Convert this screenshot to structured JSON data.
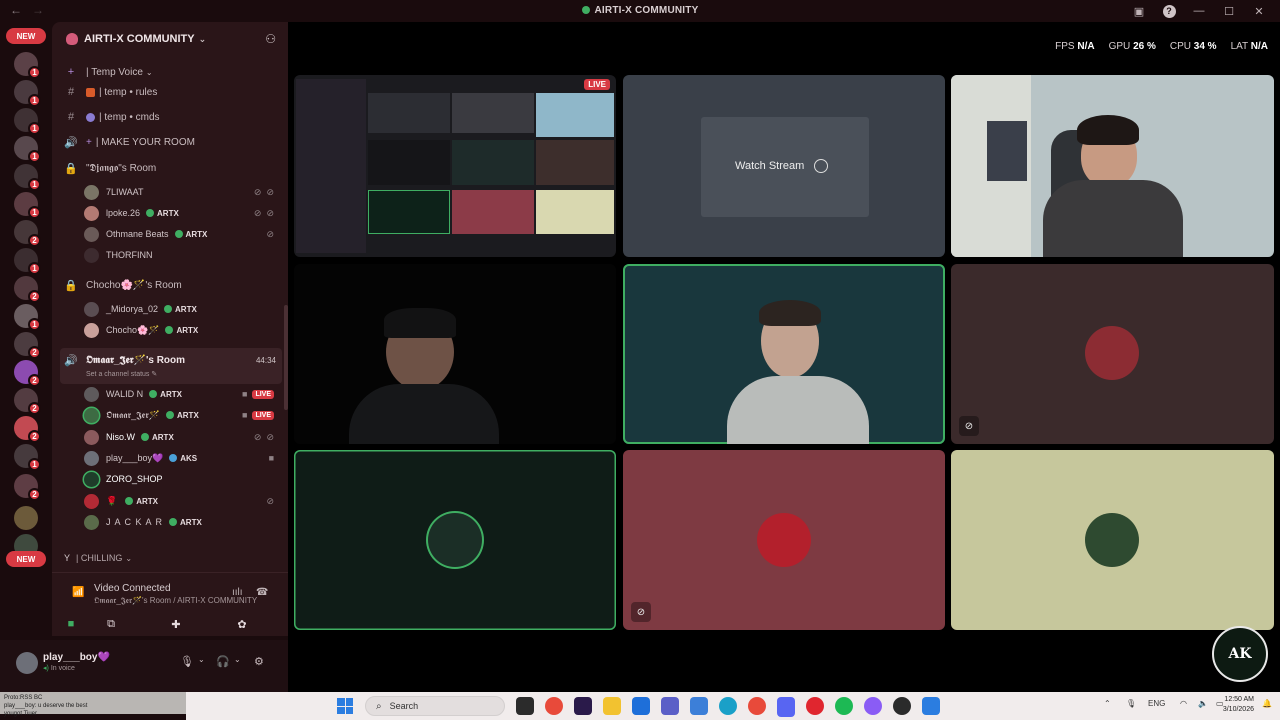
{
  "window": {
    "title": "AIRTI-X COMMUNITY"
  },
  "server": {
    "name": "AIRTI-X COMMUNITY"
  },
  "rail": {
    "new_label": "NEW",
    "new_label_bottom": "NEW",
    "badges": [
      "1",
      "1",
      "1",
      "1",
      "1",
      "1",
      "2",
      "1",
      "2",
      "1",
      "2",
      "2",
      "2",
      "2",
      "1",
      "2",
      "2",
      "2"
    ]
  },
  "channels": {
    "temp_voice": "| Temp Voice",
    "temp_rules": "| temp • rules",
    "temp_cmds": "| temp • cmds",
    "make_room": "| MAKE YOUR ROOM",
    "django_room": "\"𝕯𝖏𝖆𝖓𝖌𝖔\"s Room",
    "chocho_room": "Chocho🌸🪄's Room",
    "omaar_room": "𝕺𝖒𝖆𝖆𝖗_𝕵𝖊𝖗🪄's Room",
    "omaar_time": "44:34",
    "omaar_status": "Set a channel status",
    "chilling": "| CHILLING"
  },
  "django_members": [
    {
      "name": "7LIWAAT",
      "tag": ""
    },
    {
      "name": "lpoke.26",
      "tag": "ARTX"
    },
    {
      "name": "Othmane Beats",
      "tag": "ARTX"
    },
    {
      "name": "THORFINN",
      "tag": ""
    }
  ],
  "chocho_members": [
    {
      "name": "_Midorya_02",
      "tag": "ARTX"
    },
    {
      "name": "Chocho🌸🪄",
      "tag": "ARTX"
    }
  ],
  "omaar_members": [
    {
      "name": "WALID N",
      "tag": "ARTX",
      "live": "LIVE"
    },
    {
      "name": "𝕺𝖒𝖆𝖆𝖗_𝕵𝖊𝖗🪄",
      "tag": "ARTX",
      "live": "LIVE"
    },
    {
      "name": "Niso.W",
      "tag": "ARTX",
      "live": ""
    },
    {
      "name": "play___boy💜",
      "tag": "AKS",
      "live": ""
    },
    {
      "name": "ZORO_SHOP",
      "tag": "",
      "live": ""
    },
    {
      "name": "",
      "tag": "ARTX",
      "live": ""
    },
    {
      "name": "J A C K A R",
      "tag": "ARTX",
      "live": ""
    }
  ],
  "voice_panel": {
    "title": "Video Connected",
    "subtitle": "𝕺𝖒𝖆𝖆𝖗_𝕵𝖊𝖗🪄's Room / AIRTI-X COMMUNITY"
  },
  "user": {
    "name": "play___boy💜",
    "status": "In voice"
  },
  "stage": {
    "perf": {
      "fps_label": "FPS",
      "fps": "N/A",
      "gpu_label": "GPU",
      "gpu": "26 %",
      "cpu_label": "CPU",
      "cpu": "34 %",
      "lat_label": "LAT",
      "lat": "N/A"
    },
    "watch_stream": "Watch Stream",
    "live_badge": "LIVE",
    "logo_text": "AK"
  },
  "taskbar": {
    "search_placeholder": "Search",
    "lang": "ENG",
    "time": "12:50 AM",
    "date": "3/10/2026"
  },
  "strip_text": "Proto:RSS BC\nplay___boy: u deserve the best\nyougot Tiuer"
}
